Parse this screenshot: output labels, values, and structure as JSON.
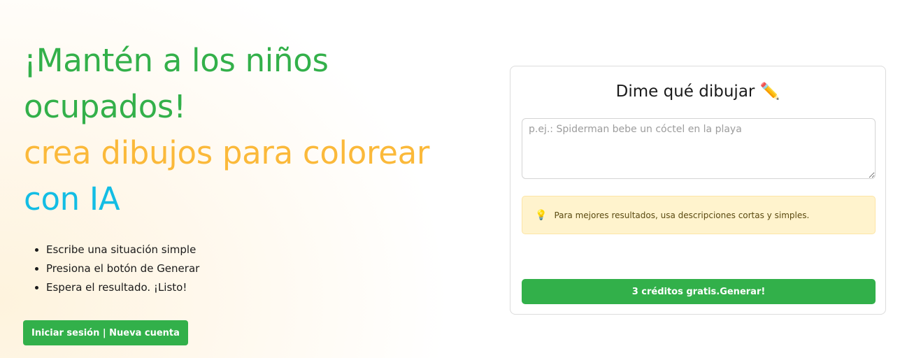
{
  "hero": {
    "headline_line1": "¡Mantén a los niños",
    "headline_line2": "ocupados!",
    "headline_line3": "crea dibujos para colorear",
    "headline_line4": "con IA",
    "steps": [
      "Escribe una situación simple",
      "Presiona el botón de Generar",
      "Espera el resultado. ¡Listo!"
    ],
    "auth_button_label": "Iniciar sesión | Nueva cuenta"
  },
  "panel": {
    "title": "Dime qué dibujar ✏️",
    "prompt_value": "",
    "prompt_placeholder": "p.ej.: Spiderman bebe un cóctel en la playa",
    "tip_icon": "💡",
    "tip_text": "Para mejores resultados, usa descripciones cortas y simples.",
    "generate_button_label": "3 créditos gratis.Generar!"
  },
  "colors": {
    "brand_green": "#32b04a",
    "headline_orange": "#fbb93a",
    "headline_blue": "#13bde4",
    "tip_background": "#fff3cd"
  }
}
